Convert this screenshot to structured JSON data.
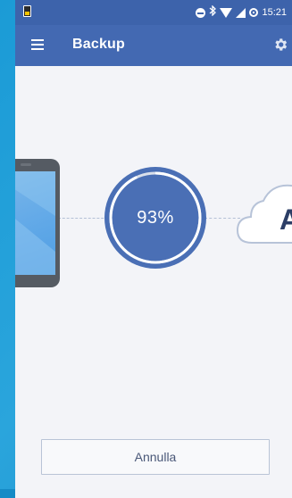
{
  "status_bar": {
    "time": "15:21",
    "icons": [
      "notification-app-icon",
      "do-not-disturb-icon",
      "bluetooth-icon",
      "wifi-icon",
      "signal-icon",
      "alarm-icon"
    ]
  },
  "app_bar": {
    "title": "Backup",
    "menu_icon": "menu-icon",
    "settings_icon": "gear-icon"
  },
  "backup": {
    "progress_fraction": 0.93,
    "progress_label": "93%",
    "source_icon": "phone-icon",
    "destination_icon": "cloud-icon",
    "destination_letter": "A"
  },
  "actions": {
    "cancel_label": "Annulla"
  },
  "colors": {
    "status_bar": "#3d63ab",
    "app_bar": "#4369b2",
    "progress_circle": "#4a6fb5",
    "progress_ring_remaining": "#d9dfea",
    "background": "#f3f4f8",
    "outer_background": "#1f9ad6"
  }
}
